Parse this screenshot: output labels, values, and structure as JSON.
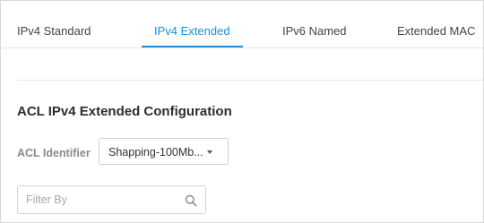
{
  "tabs": [
    {
      "label": "IPv4 Standard",
      "active": false
    },
    {
      "label": "IPv4 Extended",
      "active": true
    },
    {
      "label": "IPv6 Named",
      "active": false
    },
    {
      "label": "Extended MAC",
      "active": false
    }
  ],
  "section": {
    "title": "ACL IPv4 Extended Configuration"
  },
  "acl_identifier": {
    "label": "ACL Identifier",
    "value": "Shapping-100Mb..."
  },
  "filter": {
    "placeholder": "Filter By",
    "icon": "search-icon"
  },
  "colors": {
    "accent": "#1a8fdc"
  }
}
